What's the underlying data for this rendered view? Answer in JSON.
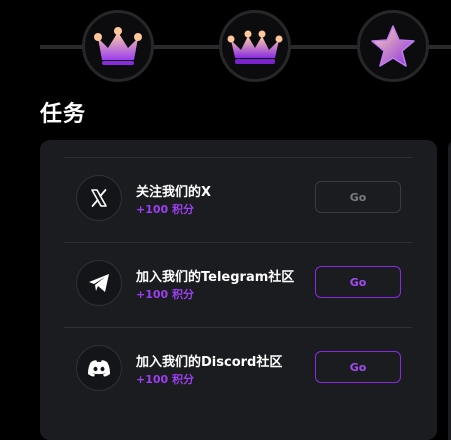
{
  "colors": {
    "background": "#000000",
    "panel": "#1b1c1f",
    "accent": "#8a2be2",
    "points": "#9b3ff0"
  },
  "levels": [
    {
      "icon": "crown-icon"
    },
    {
      "icon": "tiara-crown-icon"
    },
    {
      "icon": "star-icon"
    }
  ],
  "section": {
    "title": "任务"
  },
  "tasks": [
    {
      "icon": "x-logo-icon",
      "title": "关注我们的X",
      "points": "+100 积分",
      "button": "Go",
      "state": "done"
    },
    {
      "icon": "telegram-icon",
      "title": "加入我们的Telegram社区",
      "points": "+100 积分",
      "button": "Go",
      "state": "active"
    },
    {
      "icon": "discord-icon",
      "title": "加入我们的Discord社区",
      "points": "+100 积分",
      "button": "Go",
      "state": "active"
    }
  ]
}
